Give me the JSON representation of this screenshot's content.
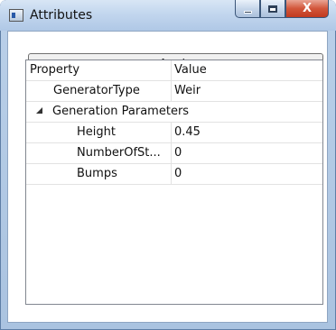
{
  "window": {
    "title": "Attributes",
    "icon": "window-app-icon",
    "caption_buttons": [
      "minimize",
      "maximize",
      "close"
    ],
    "close_glyph": "X"
  },
  "toolbar": {
    "apply_label": "Apply"
  },
  "grid": {
    "columns": [
      "Property",
      "Value"
    ],
    "rows": [
      {
        "name": "GeneratorType",
        "value": "Weir"
      },
      {
        "name": "Generation Parameters",
        "value": ""
      },
      {
        "name": "Height",
        "value": "0.45"
      },
      {
        "name": "NumberOfSt...",
        "value": "0"
      },
      {
        "name": "Bumps",
        "value": "0"
      }
    ]
  }
}
